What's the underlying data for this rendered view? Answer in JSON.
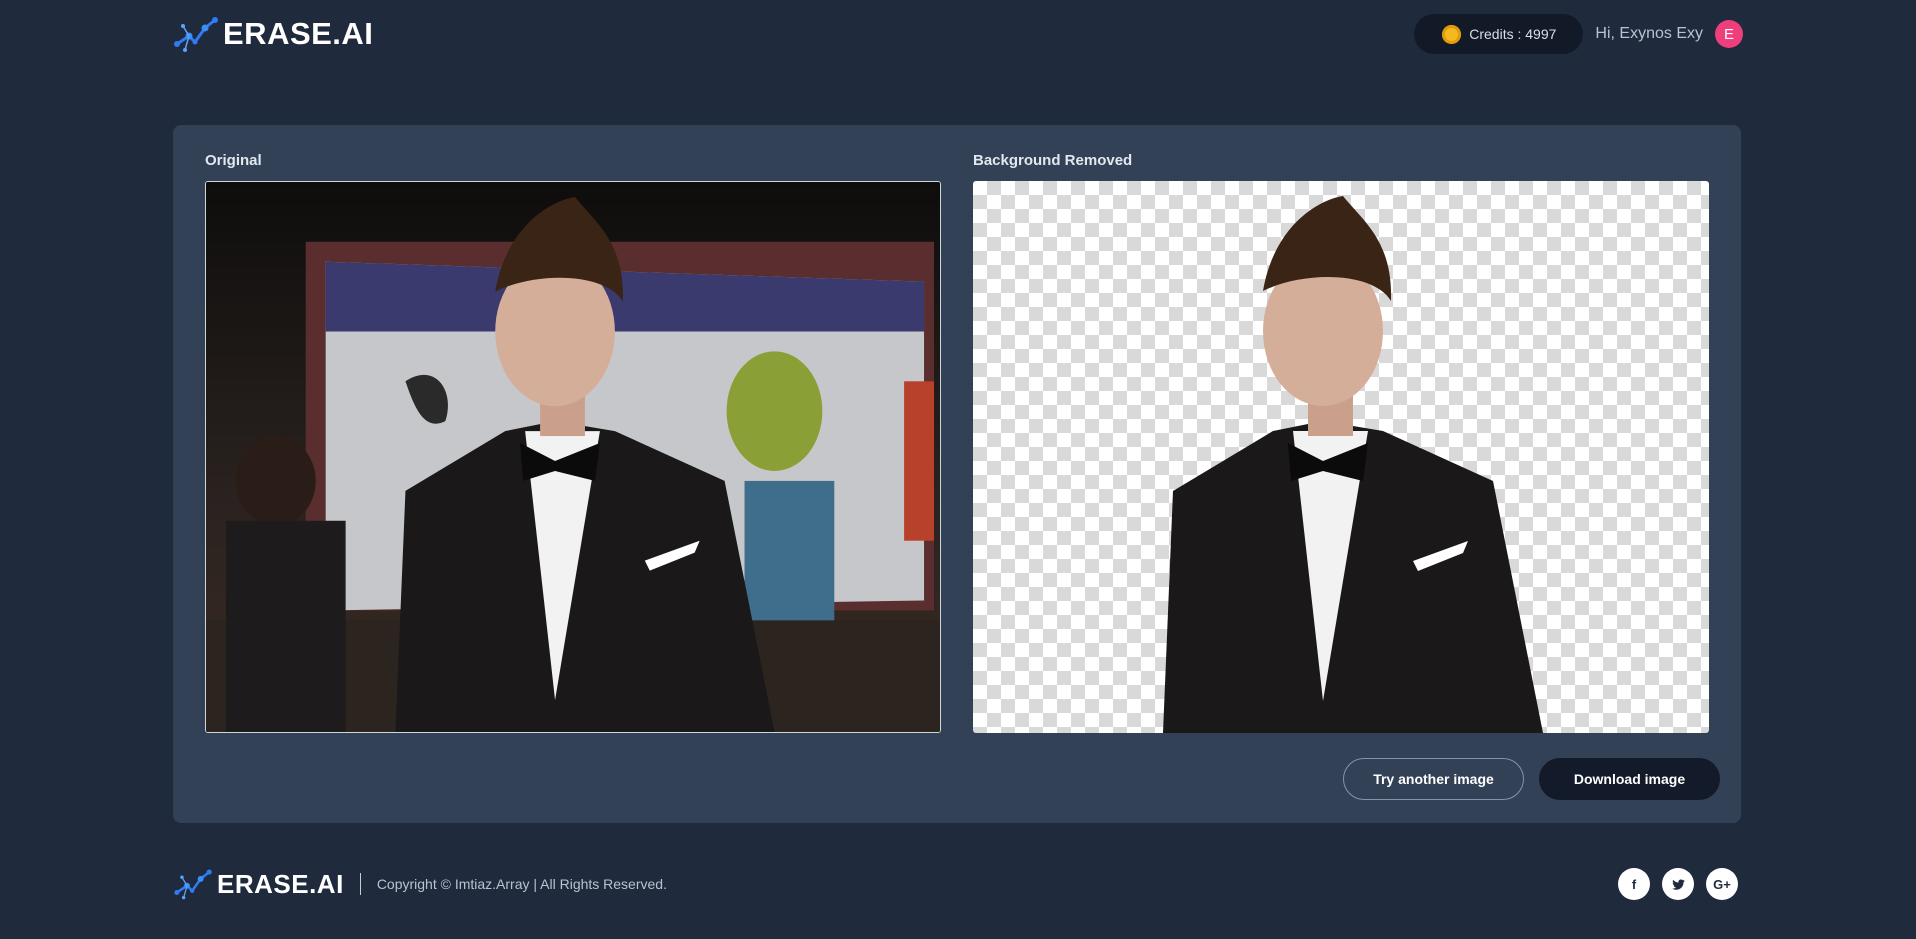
{
  "brand": {
    "name": "ERASE.AI"
  },
  "header": {
    "credits_label": "Credits : 4997",
    "greeting": "Hi, Exynos Exy",
    "avatar_initial": "E"
  },
  "main": {
    "original_label": "Original",
    "removed_label": "Background Removed",
    "try_button": "Try another image",
    "download_button": "Download image"
  },
  "footer": {
    "copyright": "Copyright © Imtiaz.Array | All Rights Reserved.",
    "socials": [
      "facebook-icon",
      "twitter-icon",
      "google-plus-icon"
    ]
  },
  "colors": {
    "background": "#1f2a3c",
    "card": "#334156",
    "pill": "#121a28",
    "avatar": "#ee3f7c",
    "coin": "#f4b91e"
  }
}
